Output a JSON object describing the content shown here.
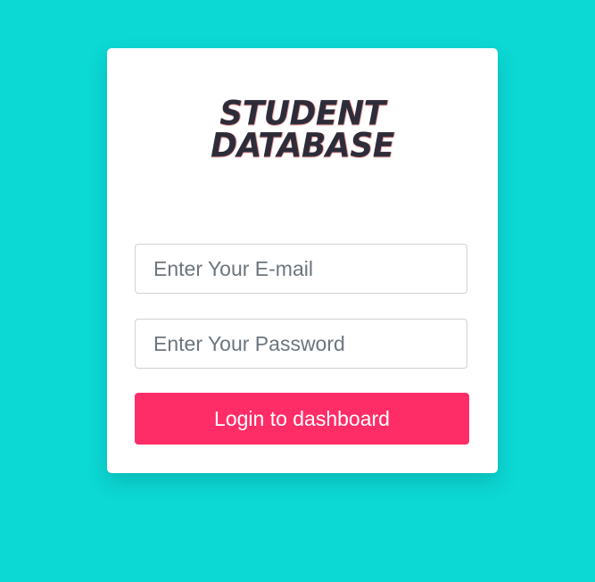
{
  "logo": {
    "line1": "STUDENT",
    "line2": "DATABASE"
  },
  "form": {
    "email_placeholder": "Enter Your E-mail",
    "email_value": "",
    "password_placeholder": "Enter Your Password",
    "password_value": "",
    "login_label": "Login to dashboard"
  },
  "colors": {
    "background": "#0cd8d4",
    "card": "#ffffff",
    "button": "#ff2d67",
    "logo_text": "#2d2d3a"
  }
}
